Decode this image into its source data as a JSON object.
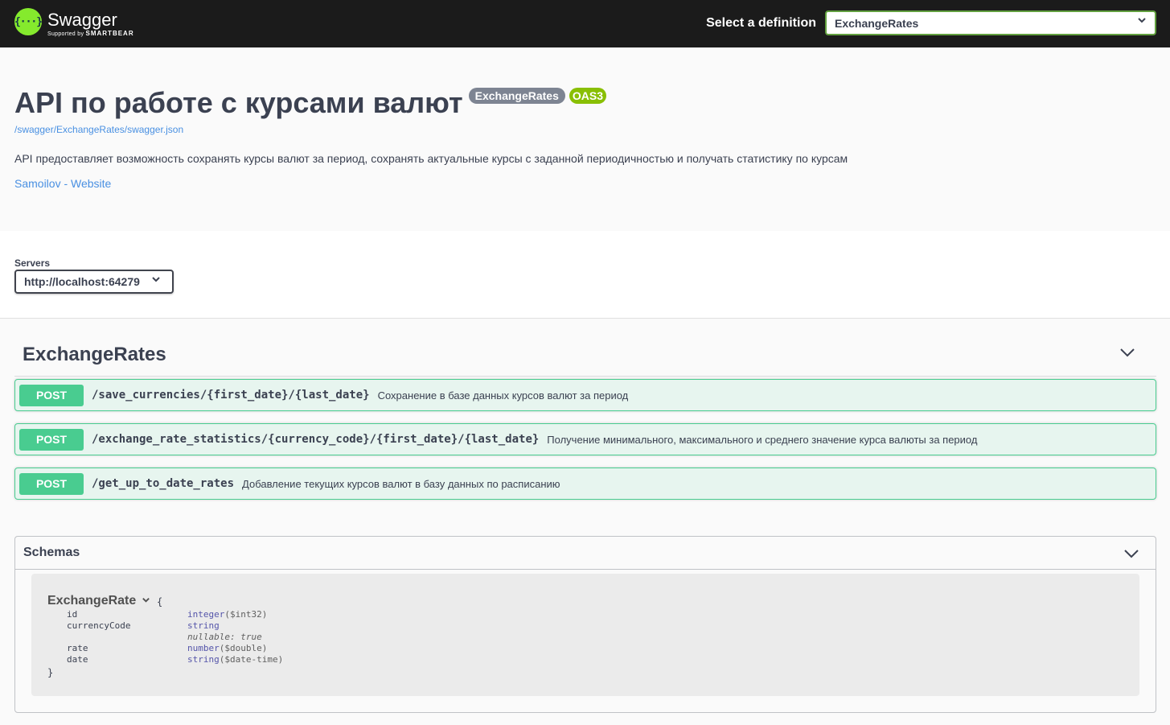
{
  "topbar": {
    "logo_icon": "{···}",
    "logo_name": "Swagger",
    "logo_sub_small": "Supported by",
    "logo_sub_brand": "SMARTBEAR",
    "definition_label": "Select a definition",
    "definition_value": "ExchangeRates",
    "accent_color": "#85ea2d"
  },
  "info": {
    "title": "API по работе с курсами валют",
    "version_badge": "ExchangeRates",
    "oas_badge": "OAS3",
    "url": "/swagger/ExchangeRates/swagger.json",
    "description": "API предоставляет возможность сохранять курсы валют за период, сохранять актуальные курсы с заданной периодичностью и получать статистику по курсам",
    "contact": "Samoilov - Website"
  },
  "servers": {
    "label": "Servers",
    "selected": "http://localhost:64279"
  },
  "tag": {
    "name": "ExchangeRates",
    "operations": [
      {
        "method": "POST",
        "path": "/save_currencies/{first_date}/{last_date}",
        "summary": "Сохранение в базе данных курсов валют за период"
      },
      {
        "method": "POST",
        "path": "/exchange_rate_statistics/{currency_code}/{first_date}/{last_date}",
        "summary": "Получение минимального, максимального и среднего значение курса валюты за период"
      },
      {
        "method": "POST",
        "path": "/get_up_to_date_rates",
        "summary": "Добавление текущих курсов валют в базу данных по расписанию"
      }
    ],
    "post_color": "#49cc90"
  },
  "schemas": {
    "title": "Schemas",
    "model": {
      "name": "ExchangeRate",
      "open_brace": "{",
      "close_brace": "}",
      "properties": [
        {
          "name": "id",
          "type": "integer",
          "format": "($int32)",
          "extra": ""
        },
        {
          "name": "currencyCode",
          "type": "string",
          "format": "",
          "extra": "nullable: true"
        },
        {
          "name": "rate",
          "type": "number",
          "format": "($double)",
          "extra": ""
        },
        {
          "name": "date",
          "type": "string",
          "format": "($date-time)",
          "extra": ""
        }
      ]
    }
  }
}
